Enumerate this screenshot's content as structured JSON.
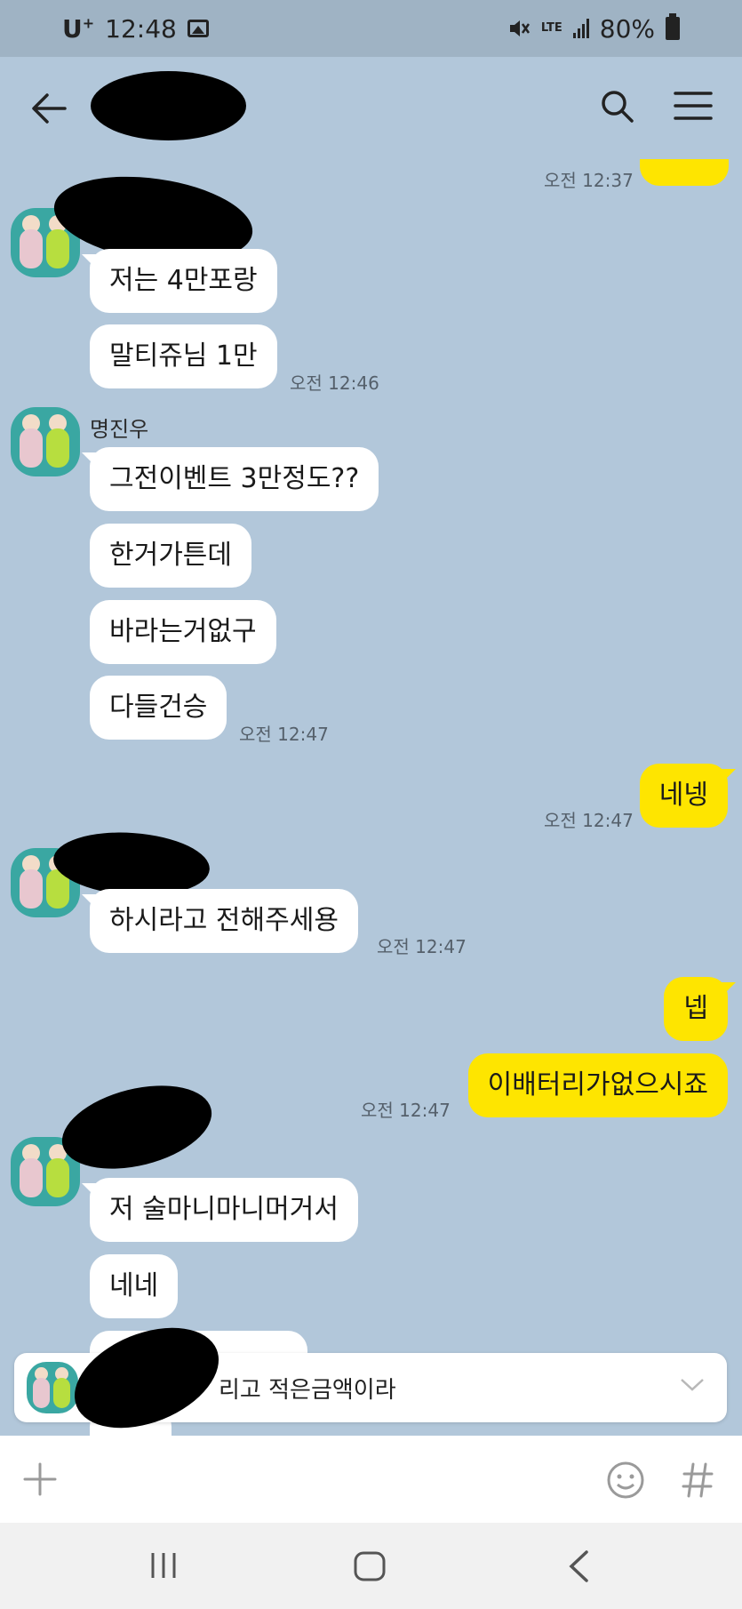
{
  "status_bar": {
    "carrier": "U",
    "carrier_sup": "+",
    "time": "12:48",
    "network": "LTE",
    "battery": "80%"
  },
  "header": {
    "back_icon": "arrow-left-icon",
    "search_icon": "search-icon",
    "menu_icon": "hamburger-menu-icon"
  },
  "messages": [
    {
      "type": "me",
      "text": "",
      "time": "오전 12:37"
    },
    {
      "type": "other",
      "text": "저는 4만포랑"
    },
    {
      "type": "other",
      "text": "말티쥬님 1만",
      "time": "오전 12:46"
    },
    {
      "type": "other",
      "sender": "명진우",
      "text": "그전이벤트 3만정도??"
    },
    {
      "type": "other",
      "text": "한거가튼데"
    },
    {
      "type": "other",
      "text": "바라는거없구"
    },
    {
      "type": "other",
      "text": "다들건승",
      "time": "오전 12:47"
    },
    {
      "type": "me",
      "text": "네넹",
      "time": "오전 12:47"
    },
    {
      "type": "other",
      "text": "하시라고 전해주세용",
      "time": "오전 12:47"
    },
    {
      "type": "me",
      "text": "넵"
    },
    {
      "type": "me",
      "text": "이배터리가없으시죠",
      "time": "오전 12:47"
    },
    {
      "type": "other",
      "text": "저 술마니마니머거서"
    },
    {
      "type": "other",
      "text": "네네"
    }
  ],
  "notice": {
    "text": "리고 적은금액이라"
  },
  "input_bar": {
    "add_icon": "plus-icon",
    "emoji_icon": "emoji-icon",
    "hash_icon": "hash-icon"
  },
  "nav_bar": {
    "recent_icon": "recent-apps-icon",
    "home_icon": "home-icon",
    "back_icon": "back-chevron-icon"
  },
  "colors": {
    "chat_bg": "#b2c7da",
    "my_bubble": "#fee500",
    "other_bubble": "#ffffff"
  }
}
